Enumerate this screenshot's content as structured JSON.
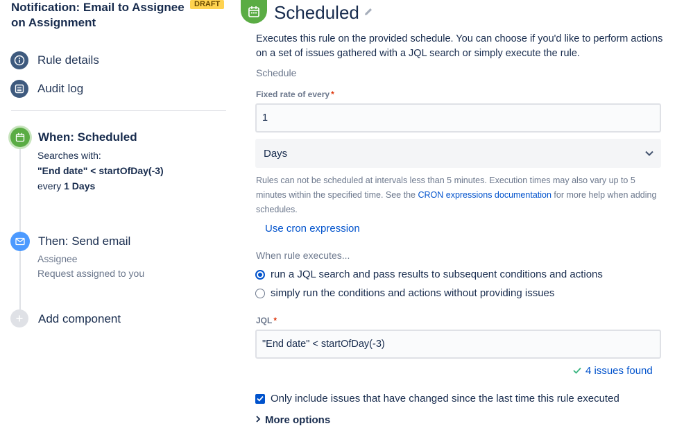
{
  "rule": {
    "title": "Notification: Email to Assignee on Assignment",
    "status_badge": "DRAFT"
  },
  "sidebar": {
    "nav": [
      {
        "label": "Rule details",
        "icon": "info-icon"
      },
      {
        "label": "Audit log",
        "icon": "list-icon"
      }
    ],
    "components": {
      "trigger": {
        "title": "When: Scheduled",
        "icon": "calendar-icon",
        "searches_label": "Searches with:",
        "jql": "\"End date\" < startOfDay(-3)",
        "every_prefix": "every",
        "every_value": "1 Days"
      },
      "action": {
        "title": "Then: Send email",
        "icon": "mail-icon",
        "recipient": "Assignee",
        "subject": "Request assigned to you"
      },
      "add": {
        "label": "Add component",
        "icon": "plus-icon"
      }
    }
  },
  "main": {
    "title": "Scheduled",
    "header_icon": "calendar-icon",
    "description": "Executes this rule on the provided schedule. You can choose if you'd like to perform actions on a set of issues gathered with a JQL search or simply execute the rule.",
    "schedule_label": "Schedule",
    "fixed_rate": {
      "label": "Fixed rate of every",
      "required_mark": "*",
      "value": "1"
    },
    "unit_select": {
      "value": "Days"
    },
    "help": {
      "before_link": "Rules can not be scheduled at intervals less than 5 minutes. Execution times may also vary up to 5 minutes within the specified time. See the ",
      "link": "CRON expressions documentation",
      "after_link": " for more help when adding schedules."
    },
    "cron_link": "Use cron expression",
    "when_executes": {
      "label": "When rule executes...",
      "options": [
        {
          "label": "run a JQL search and pass results to subsequent conditions and actions",
          "selected": true
        },
        {
          "label": "simply run the conditions and actions without providing issues",
          "selected": false
        }
      ]
    },
    "jql": {
      "label": "JQL",
      "required_mark": "*",
      "value": "\"End date\" < startOfDay(-3)"
    },
    "issues_found": "4 issues found",
    "only_changed": {
      "label": "Only include issues that have changed since the last time this rule executed",
      "checked": true
    },
    "more_options": "More options"
  },
  "colors": {
    "trigger_green": "#5aac44",
    "action_blue": "#4c9aff",
    "link_blue": "#0052cc",
    "nav_icon": "#3e5a7e",
    "draft_yellow": "#ffd350",
    "required_red": "#de350b"
  }
}
